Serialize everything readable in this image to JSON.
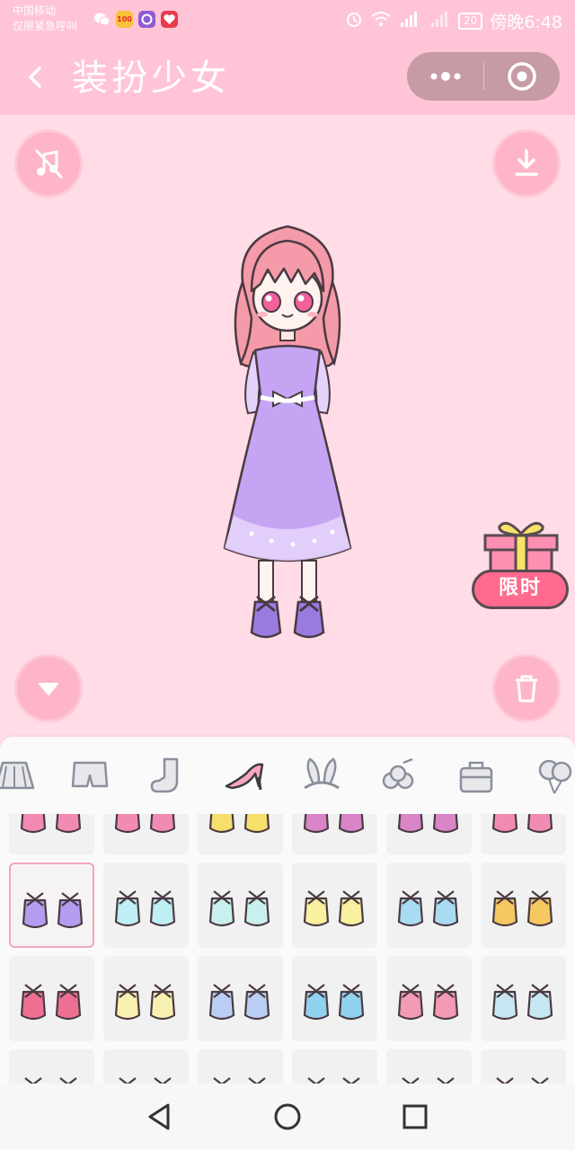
{
  "status_bar": {
    "carrier_line1": "中国移动",
    "carrier_line2": "仅限紧急呼叫",
    "app_icons": [
      {
        "name": "wechat-icon",
        "color": "#ffffff"
      },
      {
        "name": "app-100-icon",
        "label": "100",
        "color": "#f7c23a"
      },
      {
        "name": "viber-icon",
        "color": "#8e5bd6"
      },
      {
        "name": "health-app-icon",
        "color": "#e83b4b"
      }
    ],
    "battery": "20",
    "time": "傍晚6:48"
  },
  "title_bar": {
    "title": "装扮少女"
  },
  "left_controls": {
    "music_icon": "music-off-icon",
    "collapse_icon": "chevron-down-icon"
  },
  "right_controls": {
    "download_icon": "download-icon",
    "delete_icon": "trash-icon",
    "promo_label": "限时"
  },
  "categories": [
    {
      "name": "skirt",
      "icon": "skirt-icon"
    },
    {
      "name": "shorts",
      "icon": "shorts-icon"
    },
    {
      "name": "socks",
      "icon": "sock-icon"
    },
    {
      "name": "shoes",
      "icon": "high-heel-icon",
      "active": true
    },
    {
      "name": "headwear",
      "icon": "bunny-ears-icon"
    },
    {
      "name": "accessory",
      "icon": "flower-clip-icon"
    },
    {
      "name": "bag",
      "icon": "bag-icon"
    },
    {
      "name": "balloon",
      "icon": "balloon-icon"
    }
  ],
  "shoe_grid": {
    "rows": [
      [
        {
          "color": "#f28bb4"
        },
        {
          "color": "#f28bb4"
        },
        {
          "color": "#f6df6b"
        },
        {
          "color": "#d985c8"
        },
        {
          "color": "#d985c8"
        },
        {
          "color": "#f28bb4"
        }
      ],
      [
        {
          "color": "#b49cf0",
          "selected": true
        },
        {
          "color": "#bfeff2"
        },
        {
          "color": "#c9f0ec"
        },
        {
          "color": "#f9f0a0"
        },
        {
          "color": "#a9dcf3"
        },
        {
          "color": "#f6c860"
        }
      ],
      [
        {
          "color": "#ef6f93"
        },
        {
          "color": "#f8f0b0"
        },
        {
          "color": "#b9cef2"
        },
        {
          "color": "#90d3ef"
        },
        {
          "color": "#f39ab4"
        },
        {
          "color": "#c6e7f2"
        }
      ],
      [
        {
          "color": "#e5e5e5"
        },
        {
          "color": "#e5e5e5"
        },
        {
          "color": "#c4a4e8"
        },
        {
          "color": "#e5e5e5"
        },
        {
          "color": "#e5e5e5"
        },
        {
          "color": "#f28bb4"
        }
      ]
    ]
  },
  "palette": {
    "bar_pink": "#ffc5d6",
    "bg_pink": "#ffdce6",
    "button_pink": "#ffb5c9",
    "dress_purple": "#bf9cf1",
    "hair_pink": "#f59aa8"
  }
}
